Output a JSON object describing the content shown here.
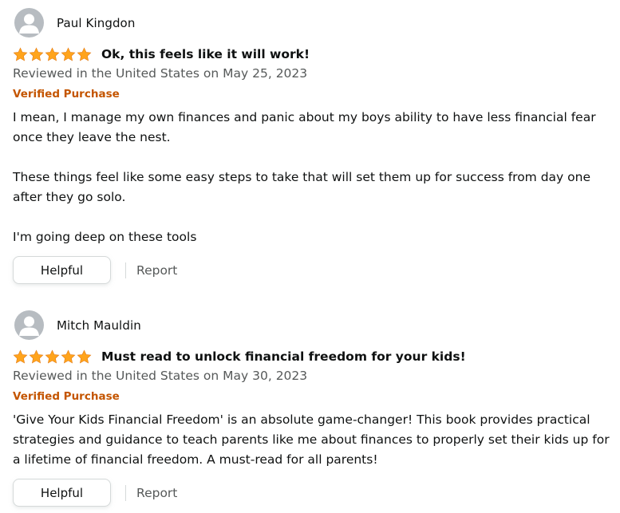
{
  "colors": {
    "star": "#ffa41c",
    "verified": "#c45500",
    "secondary_text": "#565959",
    "primary_text": "#0f1111"
  },
  "reviews": [
    {
      "author": "Paul Kingdon",
      "rating": 5,
      "title": "Ok, this feels like it will work!",
      "date": "Reviewed in the United States on May 25, 2023",
      "badge": "Verified Purchase",
      "paragraphs": [
        "I mean, I manage my own finances and panic about my boys ability to have less financial fear once they leave the nest.",
        "These things feel like some easy steps to take that will set them up for success from day one after they go solo.",
        "I'm going deep on these tools"
      ],
      "helpful_label": "Helpful",
      "report_label": "Report"
    },
    {
      "author": "Mitch Mauldin",
      "rating": 5,
      "title": "Must read to unlock financial freedom for your kids!",
      "date": "Reviewed in the United States on May 30, 2023",
      "badge": "Verified Purchase",
      "paragraphs": [
        "'Give Your Kids Financial Freedom' is an absolute game-changer! This book provides practical strategies and guidance to teach parents like me about finances to properly set their kids up for a lifetime of financial freedom. A must-read for all parents!"
      ],
      "helpful_label": "Helpful",
      "report_label": "Report"
    }
  ]
}
